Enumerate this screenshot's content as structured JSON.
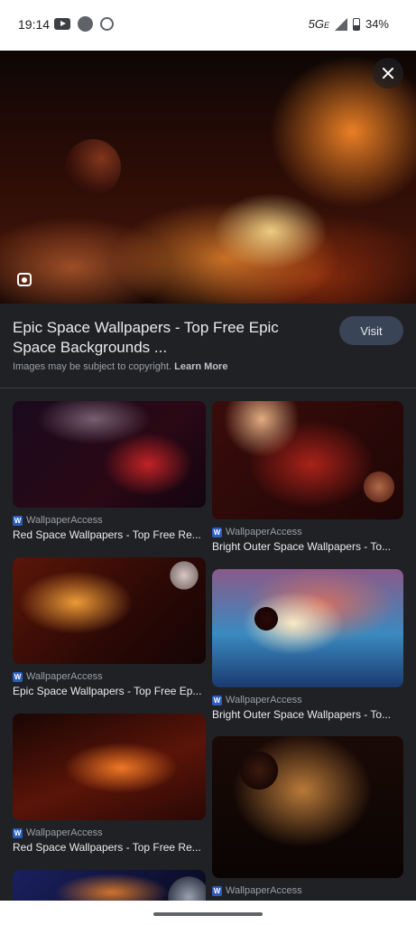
{
  "status_bar": {
    "time": "19:14",
    "network": "5G",
    "network_suffix": "E",
    "battery": "34%"
  },
  "hero": {
    "close_icon": "close-icon",
    "lens_icon": "lens-icon"
  },
  "result": {
    "title": "Epic Space Wallpapers - Top Free Epic Space Backgrounds ...",
    "visit_label": "Visit",
    "copyright_text": "Images may be subject to copyright.",
    "learn_more": "Learn More"
  },
  "related": [
    {
      "source": "WallpaperAccess",
      "title": "Red Space Wallpapers - Top Free Re..."
    },
    {
      "source": "WallpaperAccess",
      "title": "Bright Outer Space Wallpapers - To..."
    },
    {
      "source": "WallpaperAccess",
      "title": "Epic Space Wallpapers - Top Free Ep..."
    },
    {
      "source": "WallpaperAccess",
      "title": "Bright Outer Space Wallpapers - To..."
    },
    {
      "source": "WallpaperAccess",
      "title": "Red Space Wallpapers - Top Free Re..."
    },
    {
      "source": "WallpaperAccess",
      "title": ""
    }
  ],
  "favicon_letter": "W"
}
